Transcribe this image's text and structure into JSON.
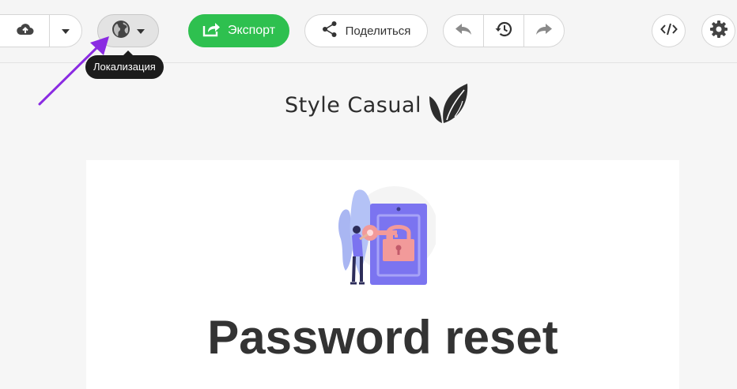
{
  "toolbar": {
    "export_label": "Экспорт",
    "share_label": "Поделиться",
    "icons": {
      "upload": "cloud-upload-icon",
      "dropdown": "chevron-down-icon",
      "locale": "globe-icon",
      "export": "export-icon",
      "share": "share-icon",
      "undo": "undo-icon",
      "history": "history-icon",
      "redo": "redo-icon",
      "code": "code-icon",
      "settings": "gear-icon"
    }
  },
  "tooltip": {
    "text": "Локализация"
  },
  "email": {
    "brand_name": "Style Casual",
    "headline": "Password reset"
  },
  "colors": {
    "export_green": "#2ec04f",
    "annotation_purple": "#8a2be2",
    "illustration_purple": "#7b74f0",
    "illustration_pink": "#f29a9a"
  }
}
